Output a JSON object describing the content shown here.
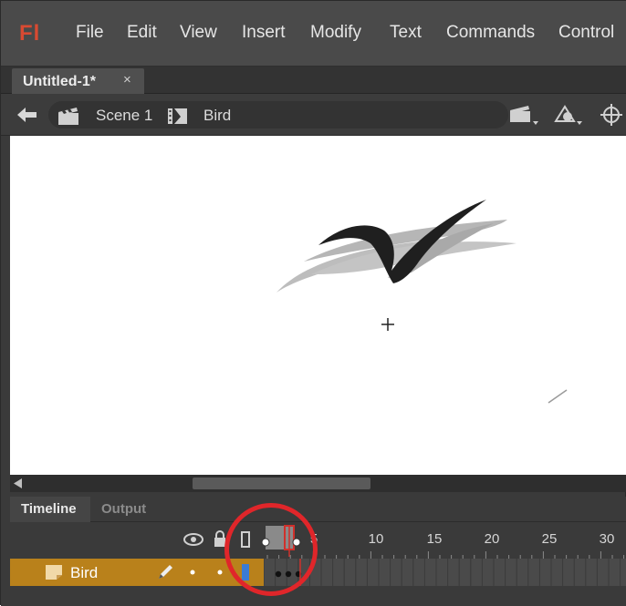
{
  "app": {
    "logo_text": "Fl",
    "accent_color": "#d94a32",
    "menu": [
      "File",
      "Edit",
      "View",
      "Insert",
      "Modify",
      "Text",
      "Commands",
      "Control"
    ]
  },
  "document": {
    "tab_title": "Untitled-1*",
    "close_glyph": "×"
  },
  "editbar": {
    "scene_label": "Scene 1",
    "symbol_label": "Bird",
    "icons": [
      "back-arrow-icon",
      "clapperboard-icon",
      "movieclip-icon",
      "edit-scene-icon",
      "edit-symbol-icon",
      "center-stage-icon"
    ]
  },
  "panels": {
    "tabs": [
      "Timeline",
      "Output"
    ],
    "active_tab": "Timeline"
  },
  "timeline": {
    "frame_numbers": [
      "5",
      "10",
      "15",
      "20",
      "25",
      "30"
    ],
    "header_icons": [
      "eye-icon",
      "lock-icon",
      "outline-icon"
    ],
    "layer": {
      "name": "Bird",
      "color": "#b9811b",
      "outline_color": "#3a7bd5",
      "keyframes": 3
    },
    "onion_skin_marker_color": "#d0302b"
  },
  "annotation": {
    "callout_color": "#e0262a"
  }
}
